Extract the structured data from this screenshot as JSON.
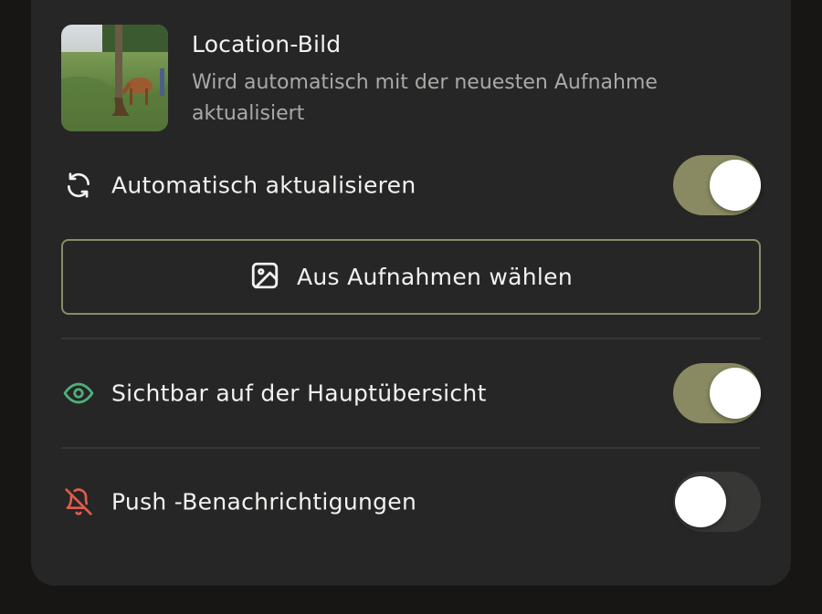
{
  "header": {
    "title": "Location-Bild",
    "subtitle": "Wird automatisch mit der neuesten Aufnahme aktualisiert"
  },
  "auto_update": {
    "label": "Automatisch aktualisieren",
    "icon": "refresh-icon",
    "enabled": true
  },
  "choose_button": {
    "label": "Aus Aufnahmen wählen",
    "icon": "image-icon"
  },
  "visibility": {
    "label": "Sichtbar auf der Hauptübersicht",
    "icon": "eye-icon",
    "icon_color": "#4fae7c",
    "enabled": true
  },
  "push": {
    "label": "Push -Benachrichtigungen",
    "icon": "bell-off-icon",
    "icon_color": "#e05d4e",
    "enabled": false
  },
  "colors": {
    "toggle_on": "#8a8a62",
    "toggle_off": "#373736",
    "card_bg": "#262626",
    "page_bg": "#171614"
  }
}
